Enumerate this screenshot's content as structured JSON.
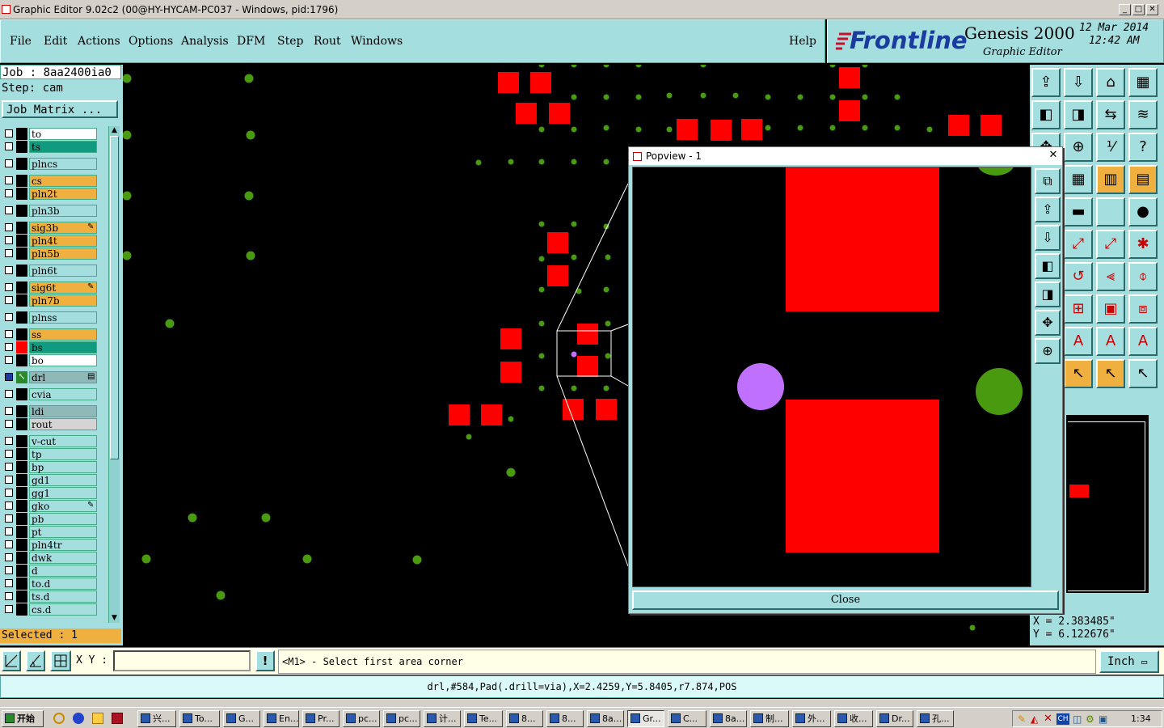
{
  "window": {
    "title": "Graphic Editor 9.02c2 (00@HY-HYCAM-PC037 - Windows, pid:1796)",
    "min": "_",
    "max": "□",
    "close": "✕"
  },
  "menu": {
    "file": "File",
    "edit": "Edit",
    "actions": "Actions",
    "options": "Options",
    "analysis": "Analysis",
    "dfm": "DFM",
    "step": "Step",
    "rout": "Rout",
    "windows": "Windows",
    "help": "Help"
  },
  "brand": {
    "logo": "Frontline",
    "product": "Genesis 2000",
    "subtitle": "Graphic Editor",
    "date": "12 Mar 2014",
    "time": "12:42 AM"
  },
  "job": {
    "job_label": "Job : 8aa2400ia0",
    "step_label": "Step: cam",
    "matrix_button": "Job Matrix ..."
  },
  "layers": [
    {
      "name": "to",
      "color": "#ffffff"
    },
    {
      "name": "ts",
      "color": "#109a80"
    },
    {
      "name": "plncs",
      "color": "#a4dede"
    },
    {
      "name": "cs",
      "color": "#f0b040"
    },
    {
      "name": "pln2t",
      "color": "#f0b040"
    },
    {
      "name": "pln3b",
      "color": "#a4dede"
    },
    {
      "name": "sig3b",
      "color": "#f0b040",
      "flag": "✎"
    },
    {
      "name": "pln4t",
      "color": "#f0b040"
    },
    {
      "name": "pln5b",
      "color": "#f0b040"
    },
    {
      "name": "pln6t",
      "color": "#a4dede"
    },
    {
      "name": "sig6t",
      "color": "#f0b040",
      "flag": "✎"
    },
    {
      "name": "pln7b",
      "color": "#f0b040"
    },
    {
      "name": "plnss",
      "color": "#a4dede"
    },
    {
      "name": "ss",
      "color": "#f0b040"
    },
    {
      "name": "bs",
      "color": "#109a80"
    },
    {
      "name": "bo",
      "color": "#ffffff"
    },
    {
      "name": "drl",
      "color": "#8fb8b8",
      "flag": "▤"
    },
    {
      "name": "cvia",
      "color": "#a4dede"
    },
    {
      "name": "ldi",
      "color": "#8fb8b8"
    },
    {
      "name": "rout",
      "color": "#d4d4d4"
    },
    {
      "name": "v-cut",
      "color": "#a4dede"
    },
    {
      "name": "tp",
      "color": "#a4dede"
    },
    {
      "name": "bp",
      "color": "#a4dede"
    },
    {
      "name": "gd1",
      "color": "#a4dede"
    },
    {
      "name": "gg1",
      "color": "#a4dede"
    },
    {
      "name": "gko",
      "color": "#a4dede",
      "flag": "✎"
    },
    {
      "name": "pb",
      "color": "#a4dede"
    },
    {
      "name": "pt",
      "color": "#a4dede"
    },
    {
      "name": "pln4tr",
      "color": "#a4dede"
    },
    {
      "name": "dwk",
      "color": "#a4dede"
    },
    {
      "name": "d",
      "color": "#a4dede"
    },
    {
      "name": "to.d",
      "color": "#a4dede"
    },
    {
      "name": "ts.d",
      "color": "#a4dede"
    },
    {
      "name": "cs.d",
      "color": "#a4dede"
    }
  ],
  "selected": "Selected : 1",
  "popview": {
    "title": "Popview - 1",
    "close": "Close"
  },
  "coords": {
    "x": "X = 2.383485\"",
    "y": "Y = 6.122676\""
  },
  "command": {
    "xy_label": "X Y :",
    "xy_value": "",
    "prompt": "<M1> - Select first area corner",
    "unit": "Inch"
  },
  "status": "drl,#584,Pad(.drill=via),X=2.4259,Y=5.8405,r7.874,POS",
  "colors": {
    "pad": "#ff0000",
    "via": "#4a9a10",
    "highlight": "#c070ff",
    "panel": "#a4dede"
  },
  "taskbar": {
    "start": "开始",
    "items": [
      "兴...",
      "To...",
      "G...",
      "En...",
      "Pr...",
      "pc...",
      "pc...",
      "计...",
      "Te...",
      "8...",
      "8...",
      "8a...",
      "Gr...",
      "C...",
      "8a...",
      "制...",
      "外...",
      "收...",
      "Dr...",
      "孔..."
    ],
    "tray_lang": "CH",
    "clock": "1:34"
  }
}
